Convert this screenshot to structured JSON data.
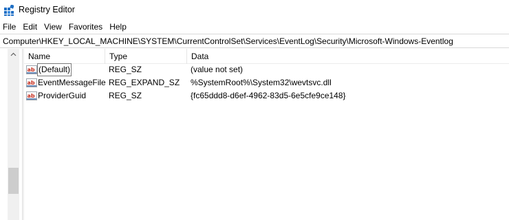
{
  "window": {
    "title": "Registry Editor",
    "icon": "registry-icon"
  },
  "menu": [
    "File",
    "Edit",
    "View",
    "Favorites",
    "Help"
  ],
  "address": "Computer\\HKEY_LOCAL_MACHINE\\SYSTEM\\CurrentControlSet\\Services\\EventLog\\Security\\Microsoft-Windows-Eventlog",
  "columns": {
    "name": "Name",
    "type": "Type",
    "data": "Data"
  },
  "rows": [
    {
      "name": "(Default)",
      "type": "REG_SZ",
      "data": "(value not set)",
      "icon": "string-value-icon",
      "focused": true
    },
    {
      "name": "EventMessageFile",
      "type": "REG_EXPAND_SZ",
      "data": "%SystemRoot%\\System32\\wevtsvc.dll",
      "icon": "string-value-icon",
      "focused": false
    },
    {
      "name": "ProviderGuid",
      "type": "REG_SZ",
      "data": "{fc65ddd8-d6ef-4962-83d5-6e5cfe9ce148}",
      "icon": "string-value-icon",
      "focused": false
    }
  ],
  "colors": {
    "icon_red": "#c42b1c",
    "icon_blue": "#1f6fc5",
    "scroll_thumb": "#cdcdcd"
  }
}
